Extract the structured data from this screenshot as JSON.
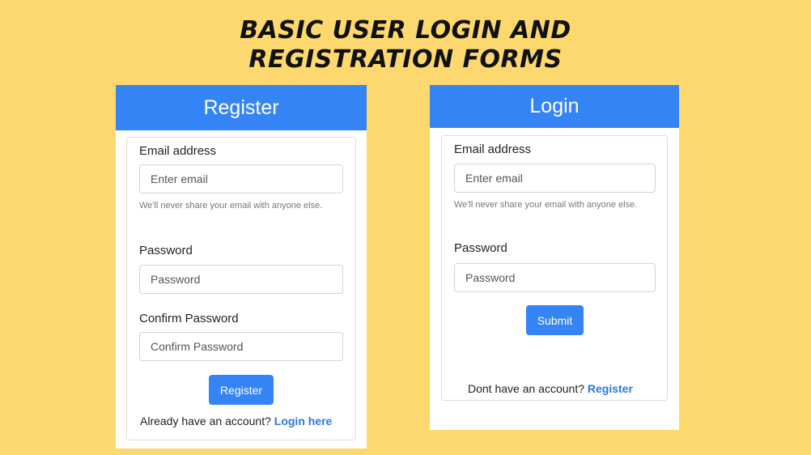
{
  "banner": {
    "line1": "BASIC USER LOGIN AND",
    "line2": "REGISTRATION FORMS"
  },
  "register": {
    "title": "Register",
    "email_label": "Email address",
    "email_placeholder": "Enter email",
    "email_help": "We'll never share your email with anyone else.",
    "password_label": "Password",
    "password_placeholder": "Password",
    "confirm_label": "Confirm Password",
    "confirm_placeholder": "Confirm Password",
    "submit_label": "Register",
    "footer_text": "Already have an account?",
    "footer_link": "Login here"
  },
  "login": {
    "title": "Login",
    "email_label": "Email address",
    "email_placeholder": "Enter email",
    "email_help": "We'll never share your email with anyone else.",
    "password_label": "Password",
    "password_placeholder": "Password",
    "submit_label": "Submit",
    "footer_text": "Dont have an account?",
    "footer_link": "Register"
  },
  "colors": {
    "background": "#fcd86e",
    "accent": "#3584f5",
    "link": "#2a76e8"
  }
}
